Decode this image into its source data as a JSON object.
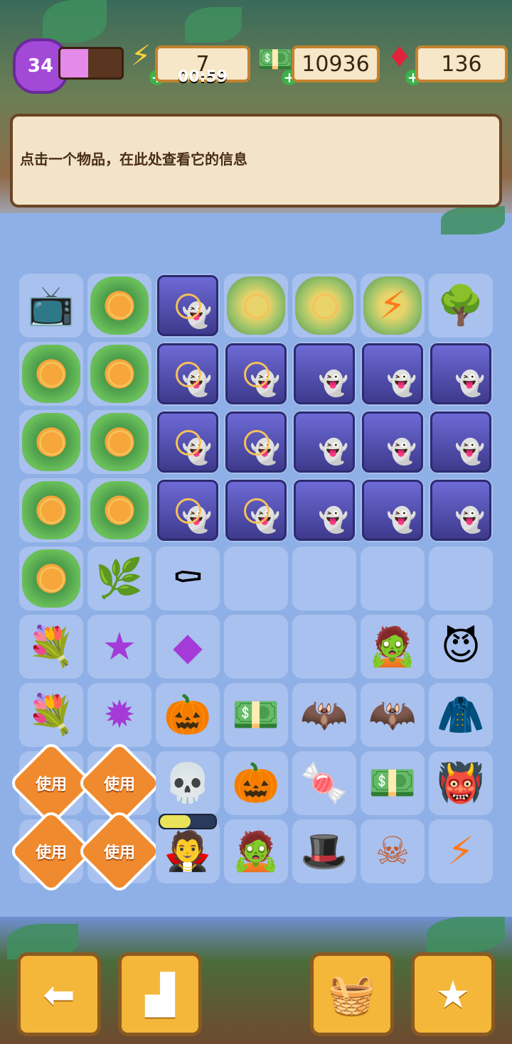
{
  "hud": {
    "level": "34",
    "xp_fraction": 0.45,
    "energy": "7",
    "energy_timer": "00:59",
    "cash": "10936",
    "gems": "136"
  },
  "info_panel": {
    "text": "点击一个物品，在此处查看它的信息"
  },
  "board": {
    "rows": [
      [
        "tv-witch-hat",
        "pumpkin-vine",
        "ghost-coffin",
        "golden-stones",
        "golden-stones",
        "golden-stones-energy",
        "haunted-tree"
      ],
      [
        "pumpkin-vine",
        "pumpkin-vine",
        "ghost-coffin",
        "ghost-coffin",
        "ghost-coffin",
        "ghost-coffin",
        "ghost-coffin"
      ],
      [
        "pumpkin-vine",
        "pumpkin-vine",
        "ghost-coffin",
        "ghost-coffin",
        "ghost-coffin",
        "ghost-coffin",
        "ghost-coffin"
      ],
      [
        "pumpkin-vine",
        "pumpkin-vine",
        "ghost-coffin",
        "ghost-coffin",
        "ghost-coffin",
        "ghost-coffin",
        "ghost-coffin"
      ],
      [
        "pumpkin-vine",
        "green-sprout",
        "bat-coffin",
        "empty",
        "empty",
        "empty",
        "empty"
      ],
      [
        "flower-basket",
        "purple-star",
        "purple-gem",
        "empty",
        "empty",
        "zombie-head",
        "devil-head"
      ],
      [
        "flower-basket",
        "purple-blob",
        "small-pumpkin",
        "cash-stack",
        "bat-staff",
        "bat-staff",
        "cloak"
      ],
      [
        "use",
        "use",
        "skull-lollipop",
        "scarecrow-witch",
        "candy",
        "cash-small",
        "red-imp"
      ],
      [
        "use",
        "use",
        "vampire",
        "frankenstein",
        "witch-hat-skull",
        "skull-cookie",
        "energy-orb"
      ]
    ],
    "use_label": "使用"
  },
  "bottom_bar": {
    "back": "back-arrow-icon",
    "podium": "podium-icon",
    "basket": "basket-icon",
    "quests": "quest-clipboard-icon"
  }
}
